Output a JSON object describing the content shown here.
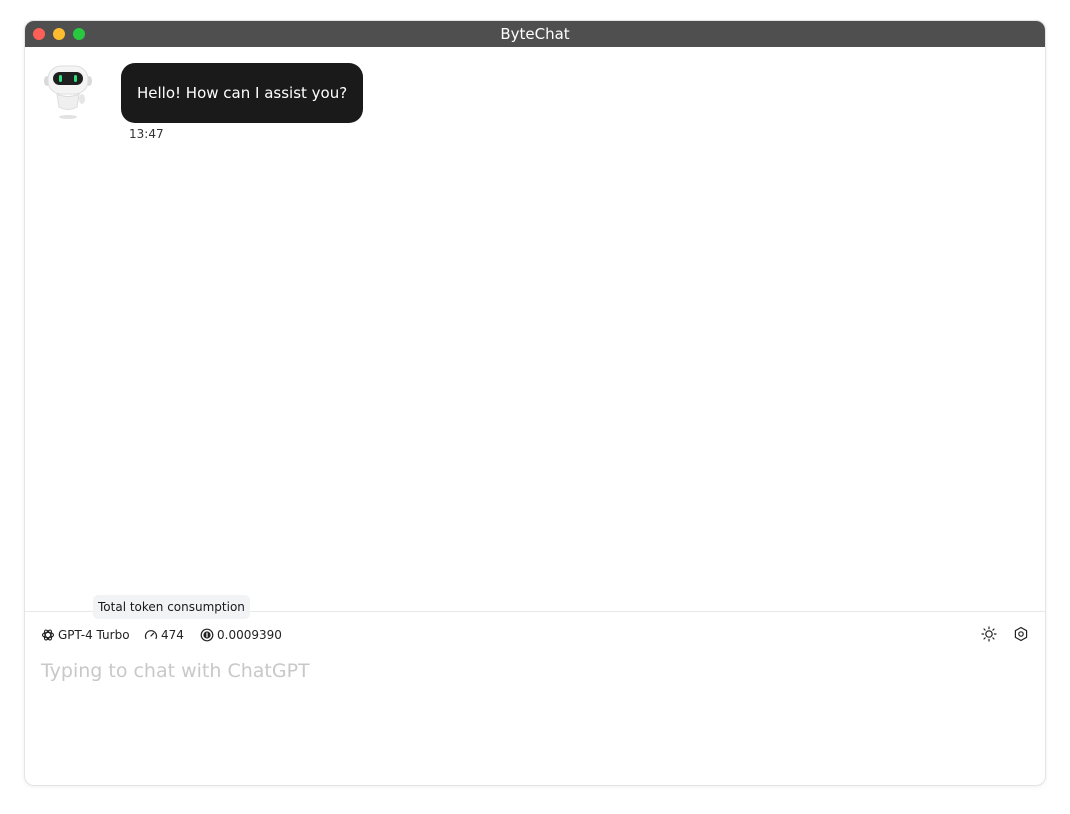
{
  "window": {
    "title": "ByteChat"
  },
  "messages": [
    {
      "role": "assistant",
      "text": "Hello! How can I assist you?",
      "time": "13:47",
      "avatar_icon": "robot-avatar-icon"
    }
  ],
  "tooltip": {
    "text": "Total token consumption"
  },
  "status": {
    "model_icon": "openai-logo-icon",
    "model": "GPT-4 Turbo",
    "tokens_icon": "gauge-icon",
    "tokens": "474",
    "cost_icon": "coin-icon",
    "cost": "0.0009390",
    "theme_icon": "sun-icon",
    "settings_icon": "settings-hexagon-icon"
  },
  "input": {
    "placeholder": "Typing to chat with ChatGPT",
    "value": ""
  },
  "colors": {
    "titlebar": "#4f4f4f",
    "bubble": "#1a1a1a",
    "close": "#fe5f57",
    "minimize": "#febc2e",
    "maximize": "#28c840",
    "robot_eyes": "#2fe07a"
  }
}
